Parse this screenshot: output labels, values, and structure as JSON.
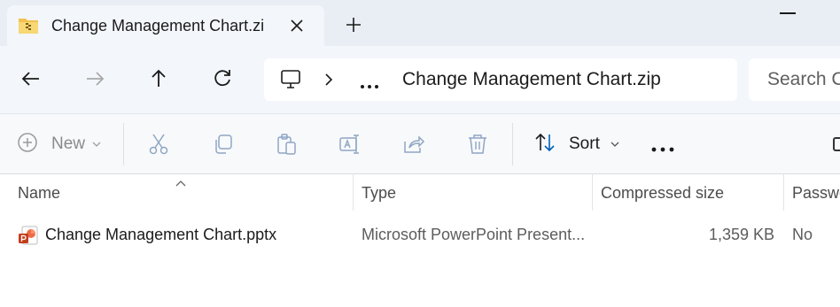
{
  "tab": {
    "title": "Change Management Chart.zi",
    "icon": "zip-folder-icon"
  },
  "nav": {
    "back_icon": "back-arrow-icon",
    "forward_icon": "forward-arrow-icon",
    "up_icon": "up-arrow-icon",
    "refresh_icon": "refresh-icon"
  },
  "address": {
    "breadcrumb": "Change Management Chart.zip"
  },
  "search": {
    "placeholder": "Search C"
  },
  "toolbar": {
    "new_label": "New",
    "sort_label": "Sort"
  },
  "columns": {
    "name": "Name",
    "type": "Type",
    "compressed_size": "Compressed size",
    "password": "Passwo"
  },
  "files": [
    {
      "name": "Change Management Chart.pptx",
      "type": "Microsoft PowerPoint Present...",
      "compressed_size": "1,359 KB",
      "password": "No"
    }
  ],
  "colors": {
    "tabstrip": "#e9eef5",
    "toolbar_bg": "#f3f6fb",
    "accent": "#005fb8",
    "ppt_red": "#c43e1c"
  }
}
